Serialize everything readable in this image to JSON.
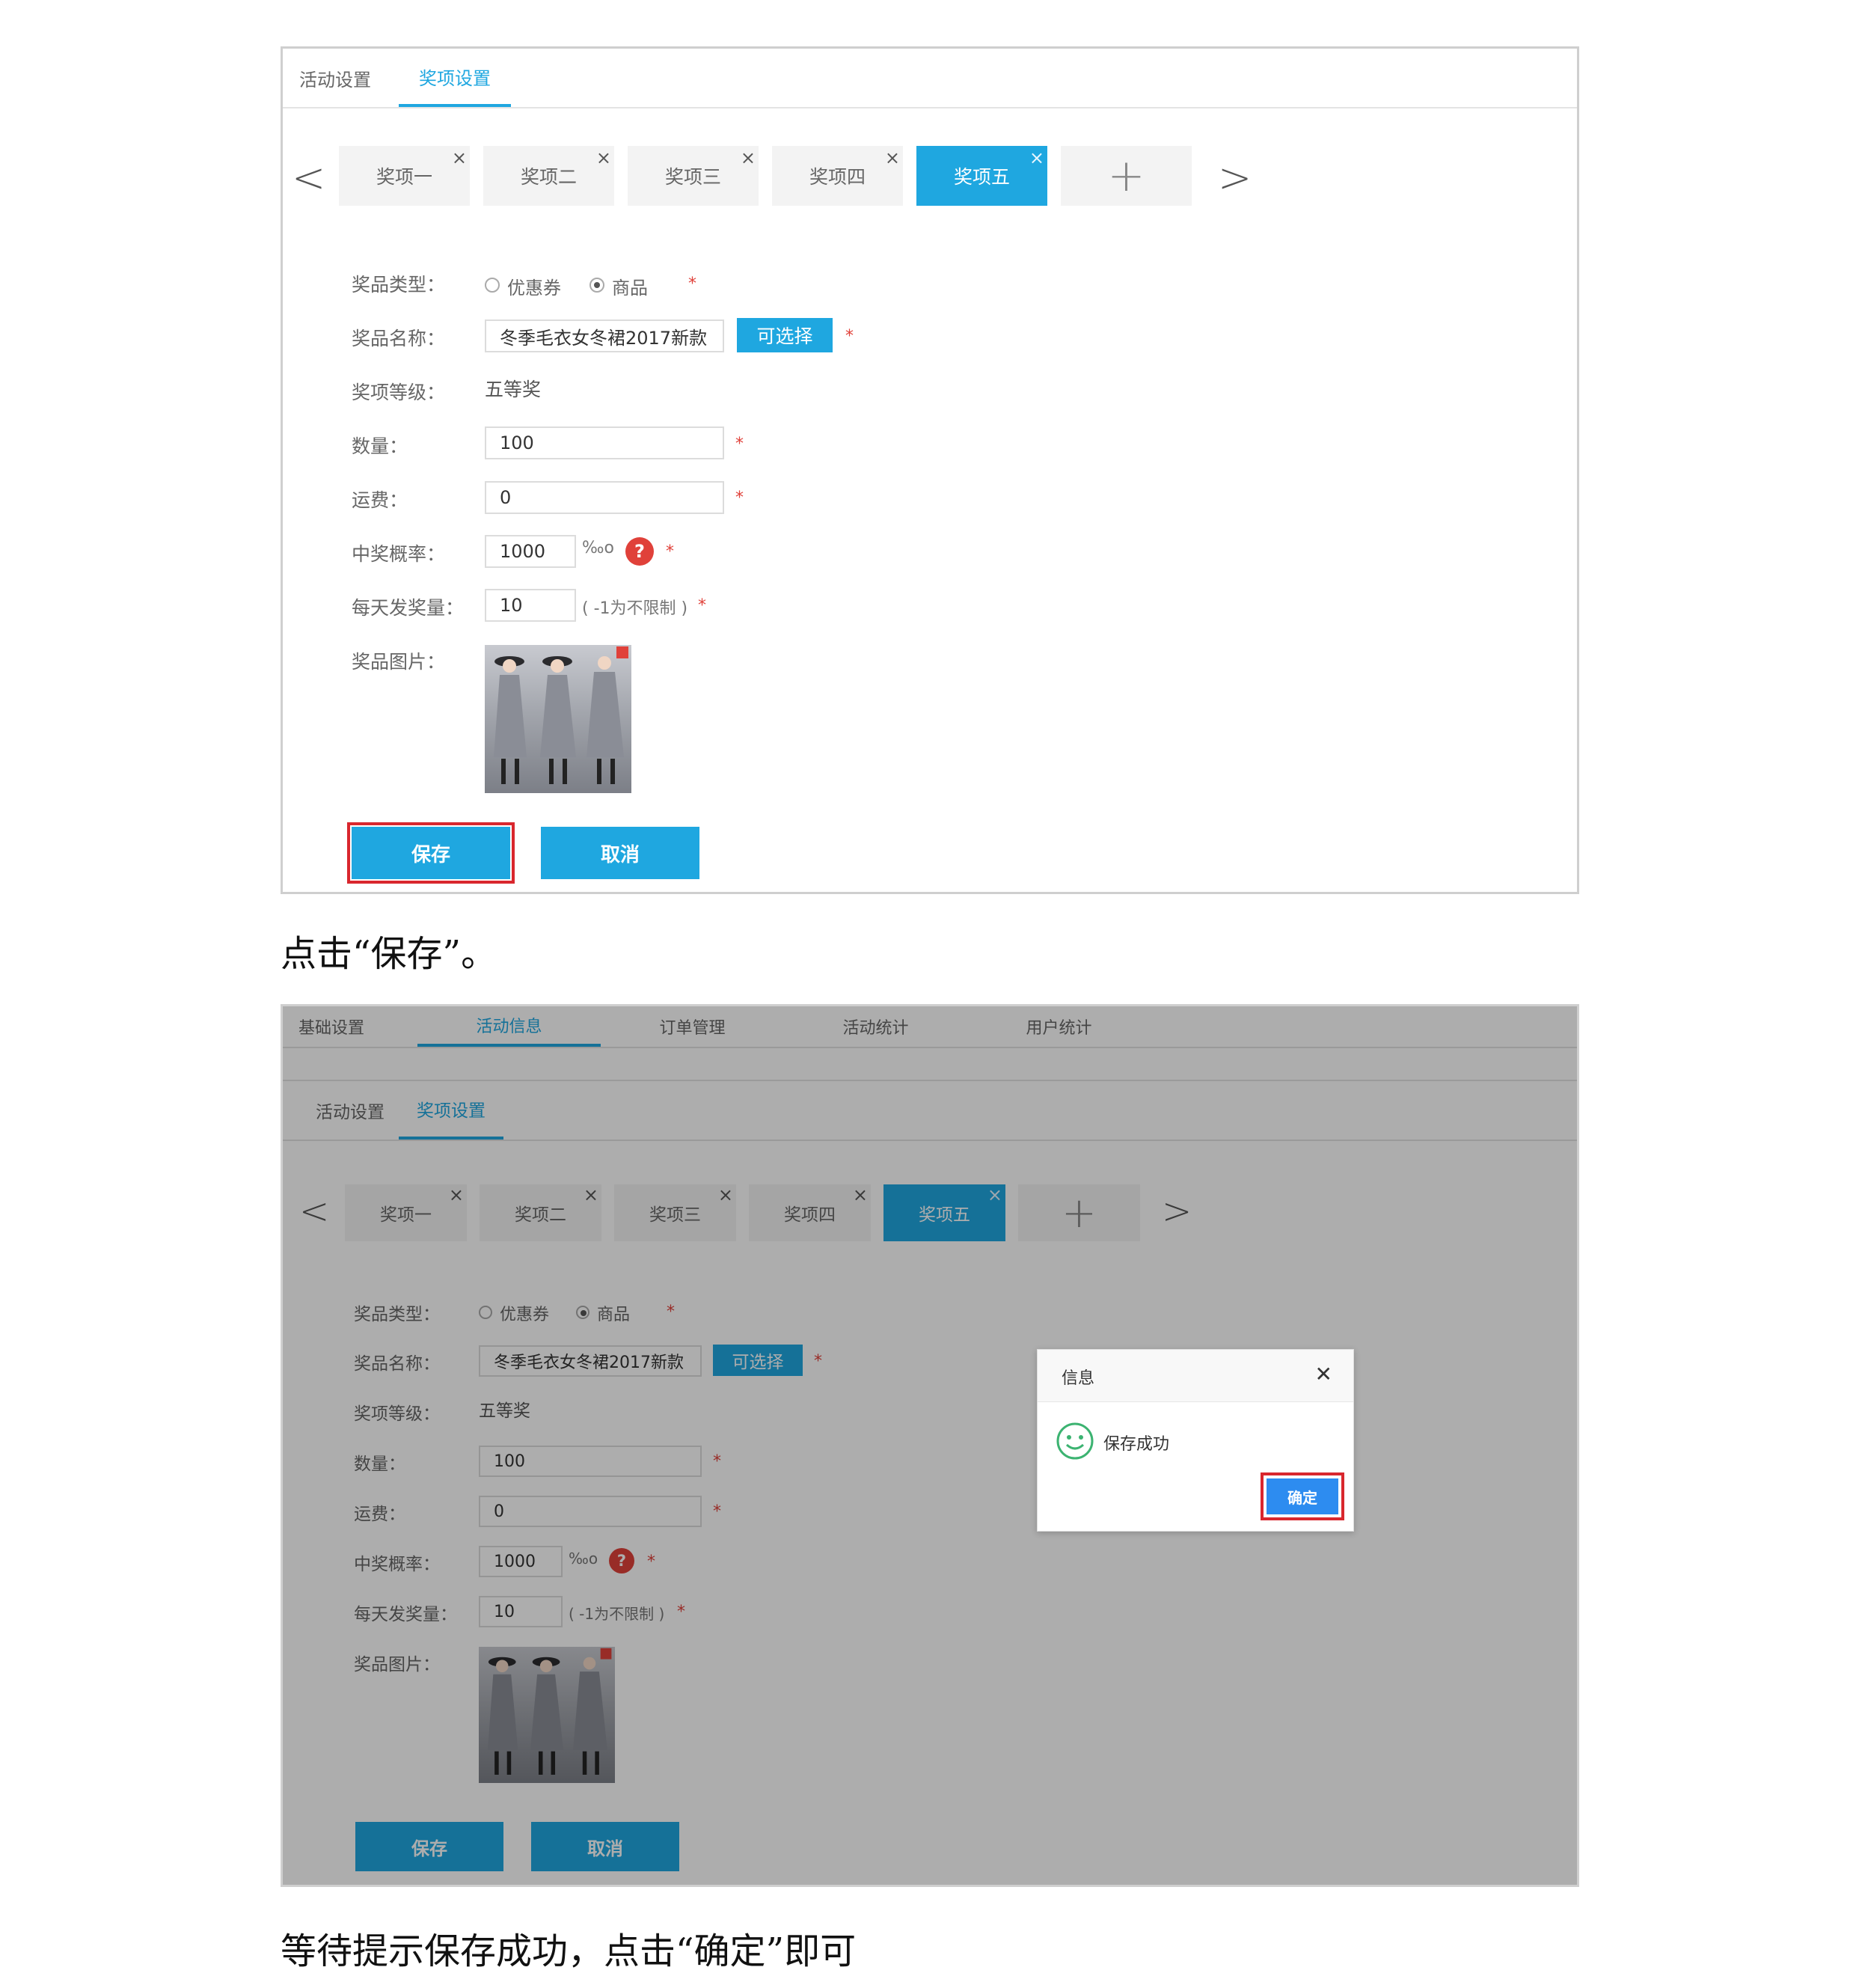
{
  "screenshot1": {
    "tabs": [
      "活动设置",
      "奖项设置"
    ],
    "prize_tabs": [
      "奖项一",
      "奖项二",
      "奖项三",
      "奖项四",
      "奖项五"
    ],
    "close_glyph": "×",
    "add_glyph": "+",
    "prev_glyph": "<",
    "next_glyph": ">",
    "form": {
      "type_label": "奖品类型：",
      "type_options": [
        "优惠券",
        "商品"
      ],
      "name_label": "奖品名称：",
      "name_value": "冬季毛衣女冬裙2017新款",
      "choose_button": "可选择",
      "level_label": "奖项等级：",
      "level_value": "五等奖",
      "qty_label": "数量：",
      "qty_value": "100",
      "freight_label": "运费：",
      "freight_value": "0",
      "prob_label": "中奖概率：",
      "prob_value": "1000",
      "prob_unit": "‰o",
      "help": "?",
      "daily_label": "每天发奖量：",
      "daily_value": "10",
      "daily_hint": "( -1为不限制 )",
      "image_label": "奖品图片：",
      "required": "*"
    },
    "save_button": "保存",
    "cancel_button": "取消"
  },
  "caption1": "点击“保存”。",
  "screenshot2": {
    "top_tabs": [
      "基础设置",
      "活动信息",
      "订单管理",
      "活动统计",
      "用户统计"
    ],
    "tabs": [
      "活动设置",
      "奖项设置"
    ],
    "prize_tabs": [
      "奖项一",
      "奖项二",
      "奖项三",
      "奖项四",
      "奖项五"
    ],
    "form": {
      "type_label": "奖品类型：",
      "type_options": [
        "优惠券",
        "商品"
      ],
      "name_label": "奖品名称：",
      "name_value": "冬季毛衣女冬裙2017新款",
      "choose_button": "可选择",
      "level_label": "奖项等级：",
      "level_value": "五等奖",
      "qty_label": "数量：",
      "qty_value": "100",
      "freight_label": "运费：",
      "freight_value": "0",
      "prob_label": "中奖概率：",
      "prob_value": "1000",
      "prob_unit": "‰o",
      "daily_label": "每天发奖量：",
      "daily_value": "10",
      "daily_hint": "( -1为不限制 )",
      "image_label": "奖品图片："
    },
    "save_button": "保存",
    "cancel_button": "取消",
    "dialog": {
      "title": "信息",
      "close_glyph": "✕",
      "message": "保存成功",
      "confirm_button": "确定"
    }
  },
  "caption2": "等待提示保存成功，点击“确定”即可",
  "colors": {
    "accent": "#1fa7e0",
    "required": "#e0413a",
    "highlight": "#d9272e",
    "success": "#3cb371"
  }
}
